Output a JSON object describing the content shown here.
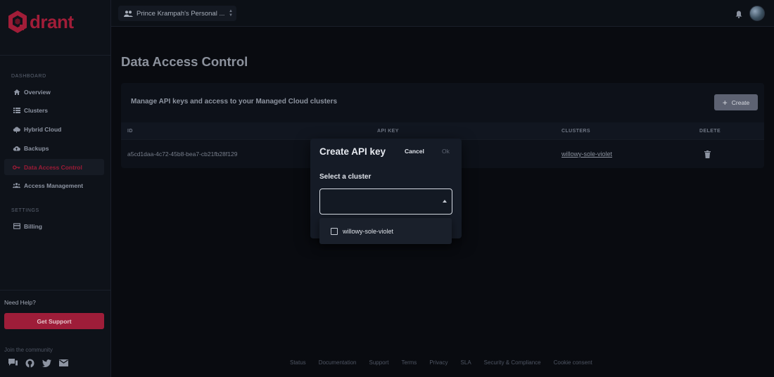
{
  "brand": {
    "logo_text": "drant",
    "accent": "#9e1d39"
  },
  "sidebar": {
    "dashboard_label": "DASHBOARD",
    "items": [
      {
        "label": "Overview",
        "icon": "home-icon"
      },
      {
        "label": "Clusters",
        "icon": "list-icon"
      },
      {
        "label": "Hybrid Cloud",
        "icon": "cloud-icon"
      },
      {
        "label": "Backups",
        "icon": "cloud-upload-icon"
      },
      {
        "label": "Data Access Control",
        "icon": "key-icon",
        "active": true
      },
      {
        "label": "Access Management",
        "icon": "people-icon"
      }
    ],
    "settings_label": "SETTINGS",
    "billing_label": "Billing",
    "need_help": "Need Help?",
    "support_label": "Get Support",
    "community_label": "Join the community"
  },
  "topbar": {
    "workspace": "Prince Krampah's Personal ..."
  },
  "page": {
    "title": "Data Access Control"
  },
  "card": {
    "header": "Manage API keys and access to your Managed Cloud clusters",
    "create_label": "Create",
    "columns": [
      "ID",
      "API KEY",
      "CLUSTERS",
      "DELETE"
    ],
    "row": {
      "id": "a5cd1daa-4c72-45b8-bea7-cb21fb28f129",
      "api_key": "",
      "cluster": "willowy-sole-violet"
    }
  },
  "modal": {
    "title": "Create API key",
    "cancel_label": "Cancel",
    "ok_label": "Ok",
    "field_label": "Select a cluster",
    "select_value": "",
    "options": [
      "willowy-sole-violet"
    ]
  },
  "footer": {
    "links": [
      "Status",
      "Documentation",
      "Support",
      "Terms",
      "Privacy",
      "SLA",
      "Security & Compliance",
      "Cookie consent"
    ]
  }
}
